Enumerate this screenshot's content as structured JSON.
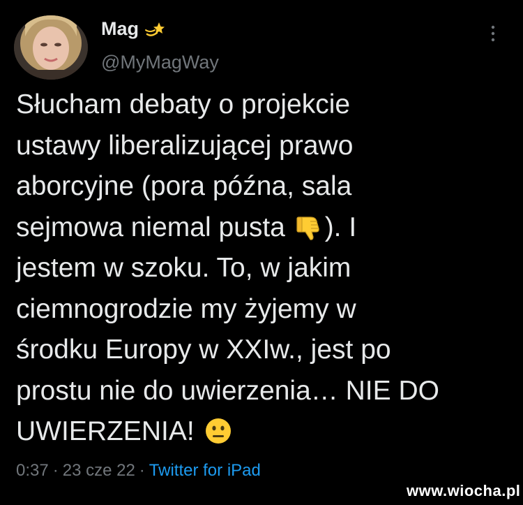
{
  "author": {
    "display_name": "Mag",
    "handle": "@MyMagWay",
    "badge_icon": "shooting-star-icon",
    "avatar": "profile-photo"
  },
  "more_icon": "more-vertical-icon",
  "tweet": {
    "lines": [
      "Słucham debaty o projekcie",
      "ustawy liberalizującej prawo",
      "aborcyjne (pora późna, sala",
      "sejmowa niemal pusta ",
      "). I",
      "jestem w szoku. To, w jakim",
      "ciemnogrodzie my żyjemy w",
      "środku Europy w XXIw., jest po",
      "prostu nie do uwierzenia… NIE DO",
      "UWIERZENIA! "
    ],
    "emoji_1": "thumbs-down-icon",
    "emoji_2": "neutral-face-icon"
  },
  "meta": {
    "time": "0:37",
    "separator": "·",
    "date": "23 cze 22",
    "source": "Twitter for iPad"
  },
  "watermark": "www.wiocha.pl",
  "colors": {
    "background": "#000000",
    "text": "#e7e9ea",
    "secondary": "#71767b",
    "link": "#1d9bf0",
    "emoji_yellow": "#ffcc33"
  }
}
